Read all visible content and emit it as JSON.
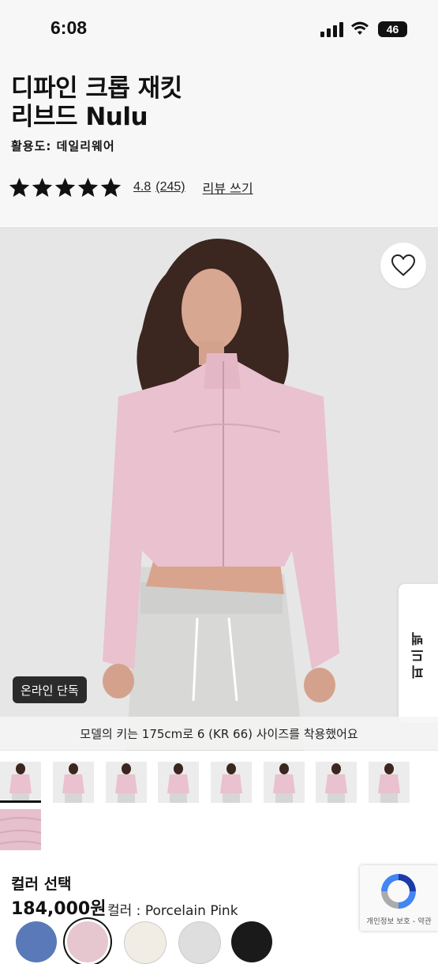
{
  "status_bar": {
    "time": "6:08",
    "battery": "46"
  },
  "product": {
    "title_line1": "디파인 크롭 재킷",
    "title_line2": "리브드 Nulu",
    "usage": "활용도: 데일리웨어",
    "rating": "4.8",
    "review_count": "(245)",
    "stars": 5,
    "write_review": "리뷰 쓰기"
  },
  "hero": {
    "badge": "온라인 단독",
    "model_caption": "모델의 키는 175cm로 6 (KR 66) 사이즈를 착용했어요",
    "side_tab": "피드백"
  },
  "gallery": {
    "thumbnails": [
      "thumb-1",
      "thumb-2",
      "thumb-3",
      "thumb-4",
      "thumb-5",
      "thumb-6",
      "thumb-7",
      "thumb-8",
      "thumb-9"
    ]
  },
  "purchase": {
    "color_select_label": "컬러 선택",
    "price": "184,000원",
    "color_label": "컬러 : Porcelain Pink",
    "swatches": [
      "#5a79b8",
      "#e6c6cf",
      "#f1ede4",
      "#dedede",
      "#1a1a1a"
    ]
  },
  "recaptcha": {
    "text": "개인정보 보호 - 약관"
  },
  "colors": {
    "star": "#111111",
    "jacket": "#e9c1cf",
    "background": "#e6e6e6"
  }
}
